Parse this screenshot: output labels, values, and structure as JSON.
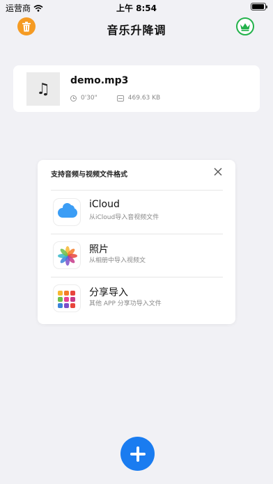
{
  "status_bar": {
    "carrier": "运营商",
    "time": "上午 8:54",
    "icons": [
      "wifi-icon",
      "battery-icon"
    ]
  },
  "nav": {
    "title": "音乐升降调",
    "left_icon": "trash-icon",
    "right_icon": "crown-icon"
  },
  "file": {
    "name": "demo.mp3",
    "duration": "0'30\"",
    "size": "469.63 KB",
    "thumb_icon": "music-note-icon"
  },
  "sheet": {
    "title": "支持音频与视频文件格式",
    "close_icon": "close-icon",
    "options": [
      {
        "title": "iCloud",
        "subtitle": "从iCloud导入音视频文件",
        "icon": "icloud-icon"
      },
      {
        "title": "照片",
        "subtitle": "从相册中导入视频文",
        "icon": "photos-icon"
      },
      {
        "title": "分享导入",
        "subtitle": "其他 APP 分享功导入文件",
        "icon": "share-apps-icon"
      }
    ]
  },
  "fab": {
    "icon": "plus-icon"
  },
  "colors": {
    "background": "#f1f1f5",
    "trash": "#f59b23",
    "crown": "#23b24b",
    "fab": "#1a7cf0",
    "icloud": "#3b9df5"
  }
}
